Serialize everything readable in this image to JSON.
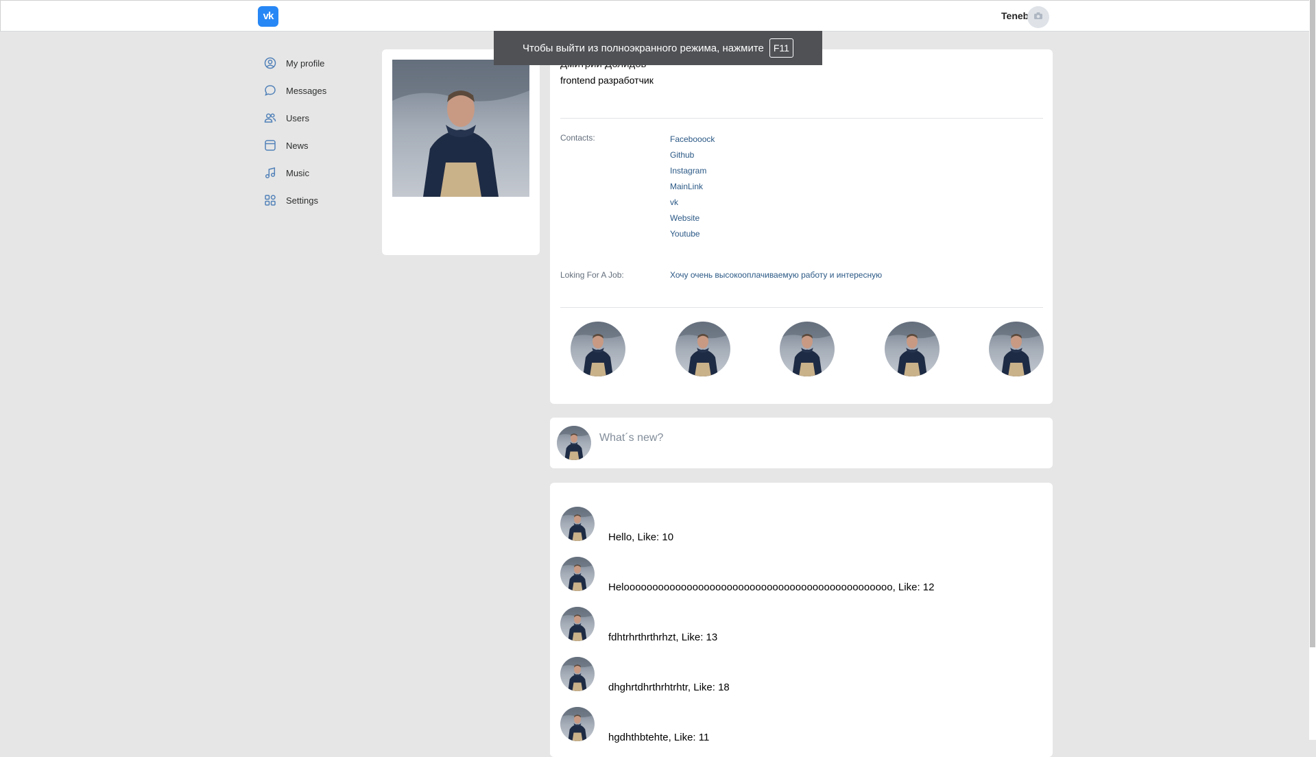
{
  "header": {
    "logo_text": "vk",
    "username": "Tenebran",
    "avatar_icon": "camera-icon"
  },
  "fullscreen_toast": {
    "text": "Чтобы выйти из полноэкранного режима, нажмите",
    "key": "F11"
  },
  "sidebar": {
    "items": [
      {
        "label": "My profile",
        "icon": "user-circle-icon"
      },
      {
        "label": "Messages",
        "icon": "chat-bubble-icon"
      },
      {
        "label": "Users",
        "icon": "users-icon"
      },
      {
        "label": "News",
        "icon": "newspaper-icon"
      },
      {
        "label": "Music",
        "icon": "music-note-icon"
      },
      {
        "label": "Settings",
        "icon": "grid-icon"
      }
    ]
  },
  "profile": {
    "name": "Дмитрий Долидов",
    "status": "frontend разработчик",
    "contacts_label": "Contacts:",
    "contacts": [
      "Facebooock",
      "Github",
      "Instagram",
      "MainLink",
      "vk",
      "Website",
      "Youtube"
    ],
    "job_label": "Loking For A Job:",
    "job_description": "Хочу очень высокооплачиваемую работу и интересную"
  },
  "new_post": {
    "placeholder": "What´s new?"
  },
  "posts": [
    {
      "text": "Hello, Like: 10"
    },
    {
      "text": "Helooooooooooooooooooooooooooooooooooooooooooooooo, Like: 12"
    },
    {
      "text": "fdhtrhrthrthrhzt, Like: 13"
    },
    {
      "text": "dhghrtdhrthrhtrhtr, Like: 18"
    },
    {
      "text": "hgdhthbtehte, Like: 11"
    }
  ],
  "colors": {
    "accent": "#2787f5",
    "link": "#2a5885",
    "background": "#e6e6e6"
  }
}
